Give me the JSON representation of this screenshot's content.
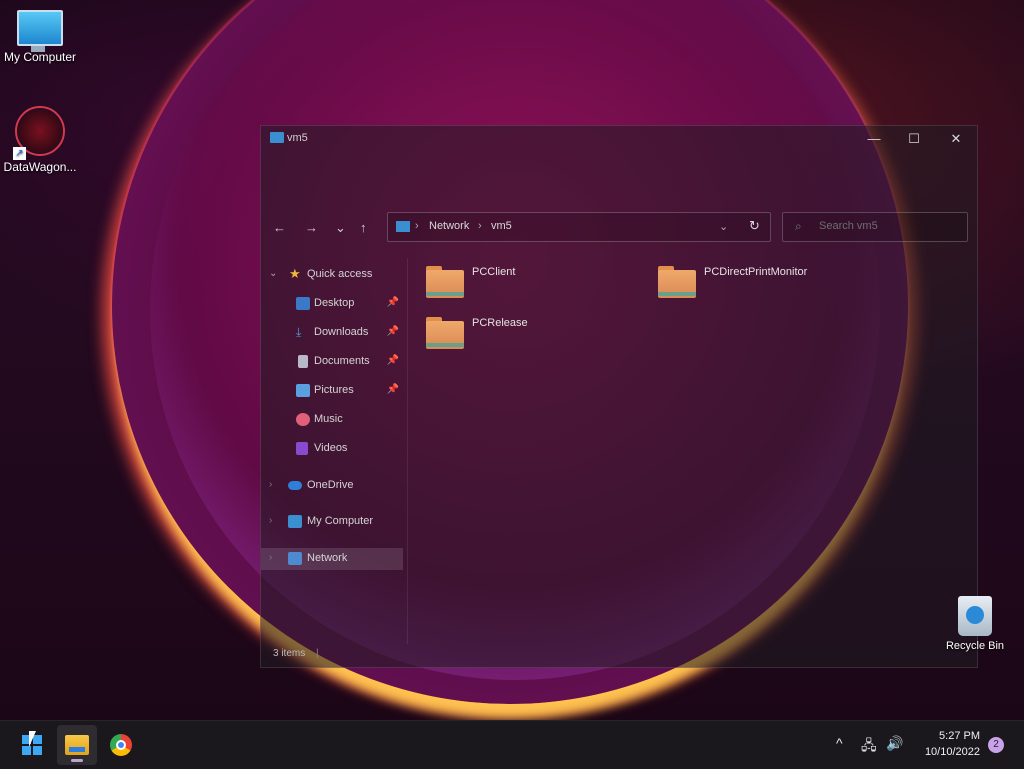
{
  "desktop": {
    "icons": [
      {
        "label": "My Computer",
        "icon": "monitor-icon"
      },
      {
        "label": "DataWagon...",
        "icon": "datawagon-app-icon"
      }
    ],
    "recycle_bin": {
      "label": "Recycle Bin",
      "icon": "recycle-bin-icon"
    }
  },
  "window": {
    "title": "vm5",
    "controls": {
      "minimize": "—",
      "maximize": "☐",
      "close": "✕"
    },
    "nav": {
      "back": "←",
      "forward": "→",
      "recent": "⌄",
      "up": "↑"
    },
    "address": {
      "crumbs": [
        "Network",
        "vm5"
      ],
      "separator": "›",
      "dropdown": "⌄",
      "refresh": "↻"
    },
    "search": {
      "placeholder": "Search vm5"
    },
    "sidebar": {
      "items": [
        {
          "label": "Quick access",
          "icon": "star-icon",
          "expanded": true
        },
        {
          "label": "Desktop",
          "icon": "desktop-folder-icon",
          "pinned": true
        },
        {
          "label": "Downloads",
          "icon": "download-icon",
          "pinned": true
        },
        {
          "label": "Documents",
          "icon": "documents-icon",
          "pinned": true
        },
        {
          "label": "Pictures",
          "icon": "pictures-icon",
          "pinned": true
        },
        {
          "label": "Music",
          "icon": "music-icon"
        },
        {
          "label": "Videos",
          "icon": "videos-icon"
        },
        {
          "label": "OneDrive",
          "icon": "cloud-icon"
        },
        {
          "label": "My Computer",
          "icon": "computer-icon"
        },
        {
          "label": "Network",
          "icon": "network-icon",
          "selected": true
        }
      ]
    },
    "folders": [
      {
        "name": "PCClient"
      },
      {
        "name": "PCDirectPrintMonitor"
      },
      {
        "name": "PCRelease"
      }
    ],
    "status": {
      "count": "3 items"
    }
  },
  "taskbar": {
    "apps": [
      {
        "name": "start",
        "icon": "windows-start-icon"
      },
      {
        "name": "file-explorer",
        "icon": "file-explorer-icon",
        "active": true
      },
      {
        "name": "chrome",
        "icon": "chrome-icon"
      }
    ],
    "tray": {
      "overflow": "^",
      "network": "🖧",
      "volume": "🔊"
    },
    "clock": {
      "time": "5:27 PM",
      "date": "10/10/2022"
    },
    "notifications": "2"
  },
  "colors": {
    "accent": "#3ba7f5",
    "folder": "#e89a5c",
    "selection": "#ffffff22"
  }
}
